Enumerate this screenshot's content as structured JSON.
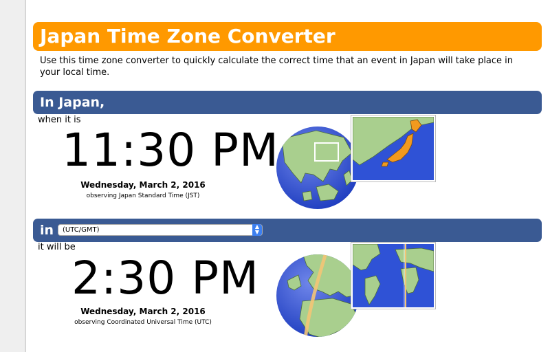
{
  "header": {
    "title": "Japan Time Zone Converter"
  },
  "intro": {
    "text": "Use this time zone converter to quickly calculate the correct time that an event in Japan will take place in your local time."
  },
  "japan": {
    "heading": "In Japan,",
    "when_label": "when it is",
    "time": "11:30 PM",
    "date": "Wednesday, March 2, 2016",
    "zone_note": "observing Japan Standard Time (JST)"
  },
  "local": {
    "heading": "in",
    "select_value": "(UTC/GMT)",
    "will_label": "it will be",
    "time": "2:30 PM",
    "date": "Wednesday, March 2, 2016",
    "zone_note": "observing Coordinated Universal Time (UTC)"
  },
  "colors": {
    "title_bar": "#ff9900",
    "section_bar": "#3a5a93",
    "ocean": "#2f52d6",
    "land": "#a9cf8e"
  },
  "icons": {
    "select_arrow": "chevron-up-down-icon"
  }
}
